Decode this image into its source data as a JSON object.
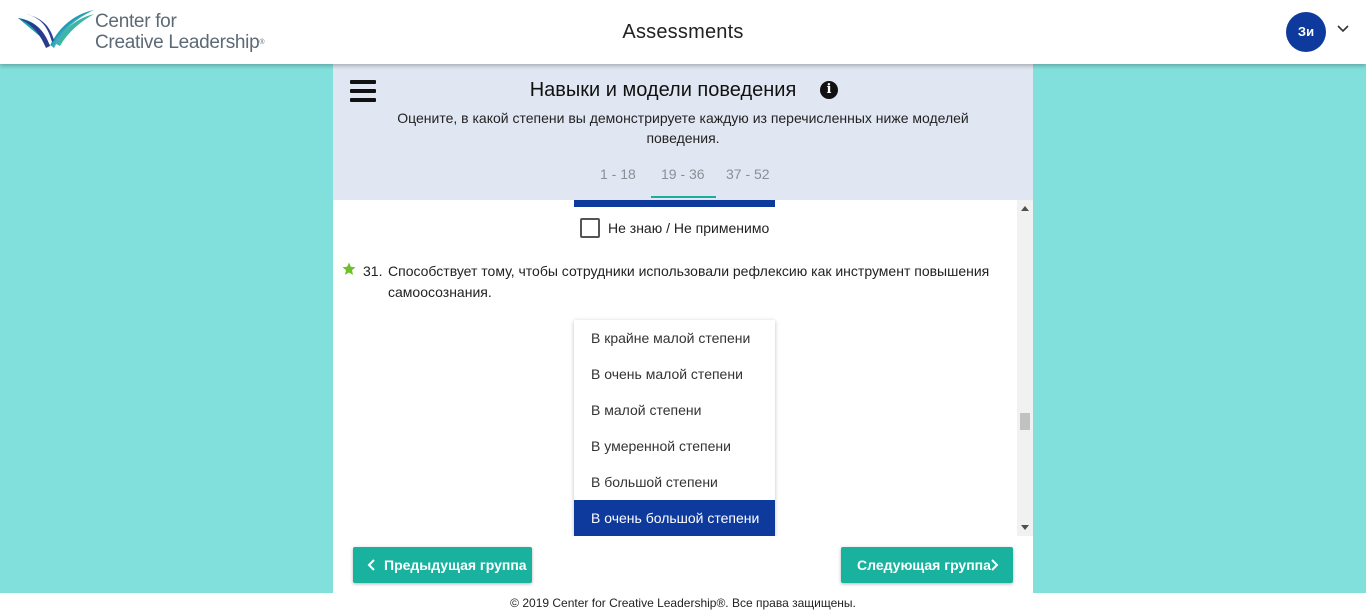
{
  "header": {
    "logo_line1": "Center for",
    "logo_line2": "Creative Leadership",
    "logo_mark": "®",
    "title": "Assessments",
    "avatar_initials": "Зи"
  },
  "section": {
    "title": "Навыки и модели поведения",
    "subtitle": "Оцените, в какой степени вы демонстрируете каждую из перечисленных ниже моделей поведения.",
    "tabs": [
      {
        "label": "1 - 18",
        "active": false
      },
      {
        "label": "19 - 36",
        "active": true
      },
      {
        "label": "37 - 52",
        "active": false
      }
    ]
  },
  "not_applicable": {
    "label": "Не знаю / Не применимо",
    "checked": false
  },
  "question": {
    "number": "31.",
    "text": "Способствует тому, чтобы сотрудники использовали рефлексию как инструмент повышения самоосознания.",
    "options": [
      {
        "label": "В крайне малой степени",
        "selected": false
      },
      {
        "label": "В очень малой степени",
        "selected": false
      },
      {
        "label": "В малой степени",
        "selected": false
      },
      {
        "label": "В умеренной степени",
        "selected": false
      },
      {
        "label": "В большой степени",
        "selected": false
      },
      {
        "label": "В очень большой степени",
        "selected": true
      }
    ]
  },
  "nav": {
    "prev_label": "Предыдущая группа",
    "next_label": "Следующая группа"
  },
  "footer": {
    "text": "© 2019 Center for Creative Leadership®. Все права защищены."
  },
  "colors": {
    "page_bg": "#82e0dc",
    "header_bg": "#e1e7f2",
    "accent": "#19b29f",
    "selected": "#0d3a9c",
    "star": "#6fbf2a"
  },
  "icons": [
    "logo-icon",
    "chevron-down-icon",
    "menu-icon",
    "info-icon",
    "star-icon",
    "chevron-left-icon",
    "chevron-right-icon"
  ]
}
